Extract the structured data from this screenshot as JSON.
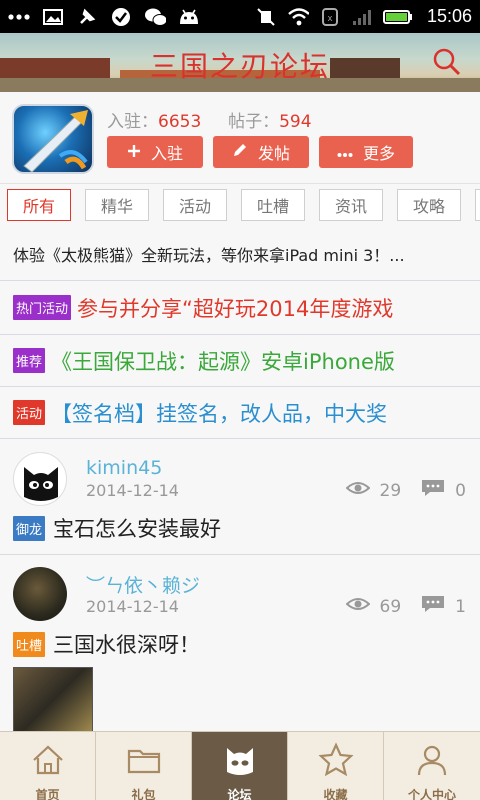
{
  "status_bar": {
    "time": "15:06"
  },
  "header": {
    "title": "三国之刃论坛"
  },
  "forum": {
    "members_label": "入驻：",
    "members_count": "6653",
    "posts_label": "帖子：",
    "posts_count": "594",
    "buttons": [
      {
        "icon": "plus-icon",
        "label": "入驻"
      },
      {
        "icon": "pencil-icon",
        "label": "发帖"
      },
      {
        "icon": "more-icon",
        "label": "更多"
      }
    ]
  },
  "tabs": [
    "所有",
    "精华",
    "活动",
    "吐槽",
    "资讯",
    "攻略"
  ],
  "notices": [
    {
      "tag": "",
      "text": "体验《太极熊猫》全新玩法，等你来拿iPad mini 3！...",
      "text_color": "#222222"
    },
    {
      "tag": "热门活动",
      "tag_color": "#9b2fc9",
      "text": "参与并分享“超好玩2014年度游戏",
      "text_color": "#e0392c"
    },
    {
      "tag": "推荐",
      "tag_color": "#9b2fc9",
      "text": "《王国保卫战：起源》安卓iPhone版",
      "text_color": "#3aa83a"
    },
    {
      "tag": "活动",
      "tag_color": "#e0392c",
      "text": "【签名档】挂签名，改人品，中大奖",
      "text_color": "#2a8fd0"
    }
  ],
  "posts": [
    {
      "user": "kimin45",
      "date": "2014-12-14",
      "views": "29",
      "comments": "0",
      "tag": "御龙",
      "tag_color": "#3b7bc4",
      "title": "宝石怎么安装最好"
    },
    {
      "user": "︶ㄣ依丶赖ジ",
      "date": "2014-12-14",
      "views": "69",
      "comments": "1",
      "tag": "吐槽",
      "tag_color": "#f08a1c",
      "title": "三国水很深呀！"
    }
  ],
  "bottom_nav": [
    {
      "icon": "home-icon",
      "label": "首页"
    },
    {
      "icon": "folder-icon",
      "label": "礼包"
    },
    {
      "icon": "cat-icon",
      "label": "论坛",
      "active": true
    },
    {
      "icon": "star-icon",
      "label": "收藏"
    },
    {
      "icon": "person-icon",
      "label": "个人中心"
    }
  ]
}
